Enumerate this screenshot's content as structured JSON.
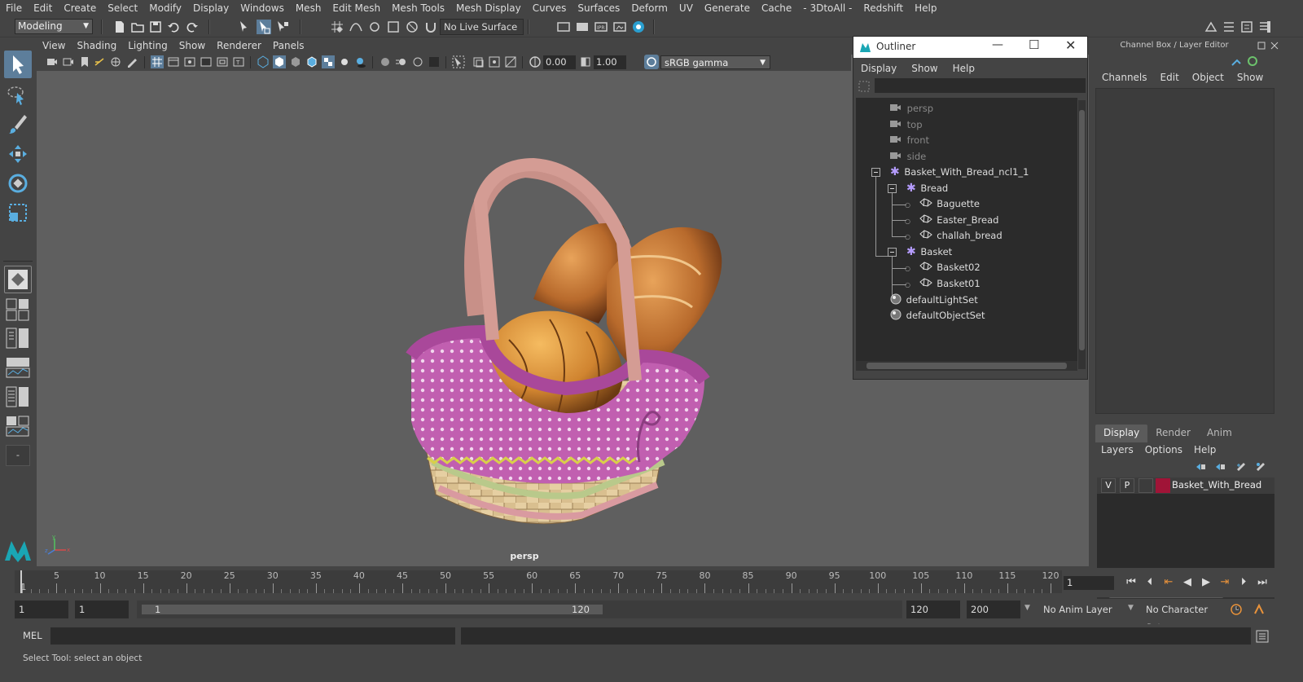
{
  "menubar": [
    "File",
    "Edit",
    "Create",
    "Select",
    "Modify",
    "Display",
    "Windows",
    "Mesh",
    "Edit Mesh",
    "Mesh Tools",
    "Mesh Display",
    "Curves",
    "Surfaces",
    "Deform",
    "UV",
    "Generate",
    "Cache",
    "- 3DtoAll -",
    "Redshift",
    "Help"
  ],
  "status_line": {
    "mode": "Modeling",
    "live_surface": "No Live Surface"
  },
  "viewport": {
    "menu": [
      "View",
      "Shading",
      "Lighting",
      "Show",
      "Renderer",
      "Panels"
    ],
    "exposure": "0.00",
    "gamma_value": "1.00",
    "color_space": "sRGB gamma",
    "camera_label": "persp",
    "axis": {
      "x": "x",
      "y": "y",
      "z": "z"
    }
  },
  "outliner": {
    "title": "Outliner",
    "menu": [
      "Display",
      "Show",
      "Help"
    ],
    "items": [
      {
        "label": "persp",
        "kind": "camera"
      },
      {
        "label": "top",
        "kind": "camera"
      },
      {
        "label": "front",
        "kind": "camera"
      },
      {
        "label": "side",
        "kind": "camera"
      },
      {
        "label": "Basket_With_Bread_ncl1_1",
        "kind": "group"
      },
      {
        "label": "Bread",
        "kind": "group"
      },
      {
        "label": "Baguette",
        "kind": "mesh"
      },
      {
        "label": "Easter_Bread",
        "kind": "mesh"
      },
      {
        "label": "challah_bread",
        "kind": "mesh"
      },
      {
        "label": "Basket",
        "kind": "group"
      },
      {
        "label": "Basket02",
        "kind": "mesh"
      },
      {
        "label": "Basket01",
        "kind": "mesh"
      },
      {
        "label": "defaultLightSet",
        "kind": "set"
      },
      {
        "label": "defaultObjectSet",
        "kind": "set"
      }
    ]
  },
  "channel_box": {
    "title": "Channel Box / Layer Editor",
    "menu": [
      "Channels",
      "Edit",
      "Object",
      "Show"
    ],
    "tabs": [
      "Display",
      "Render",
      "Anim"
    ],
    "layer_menu": [
      "Layers",
      "Options",
      "Help"
    ],
    "layer": {
      "visible": "V",
      "playback": "P",
      "name": "Basket_With_Bread",
      "color": "#a01437"
    }
  },
  "timeline": {
    "ticks": [
      "1",
      "5",
      "10",
      "15",
      "20",
      "25",
      "30",
      "35",
      "40",
      "45",
      "50",
      "55",
      "60",
      "65",
      "70",
      "75",
      "80",
      "85",
      "90",
      "95",
      "100",
      "105",
      "110",
      "115",
      "120"
    ],
    "current_frame": "1"
  },
  "range": {
    "start": "1",
    "playback_start": "1",
    "slider_start": "1",
    "slider_end": "120",
    "playback_end": "120",
    "end": "200",
    "anim_layer": "No Anim Layer",
    "character_set": "No Character Set"
  },
  "command_line": {
    "language": "MEL"
  },
  "status": {
    "help_text": "Select Tool: select an object"
  },
  "colors": {
    "selected_tool": "#5d7e9b",
    "viewport_bg": "#5f5f5f",
    "layer_color": "#a01437"
  }
}
